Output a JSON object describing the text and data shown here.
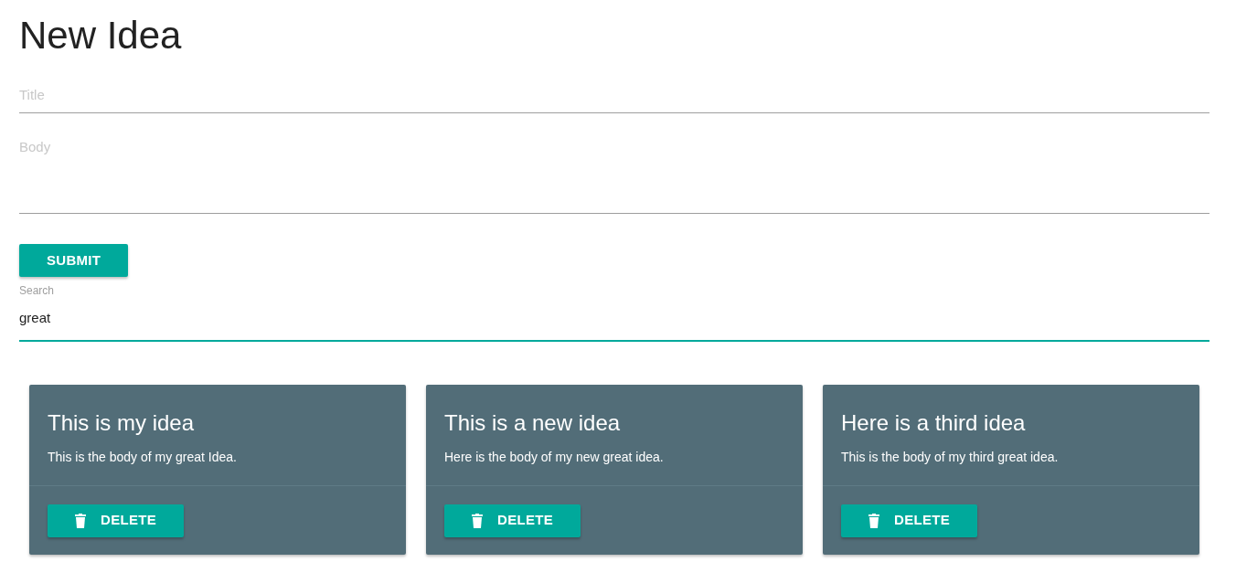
{
  "heading": "New Idea",
  "form": {
    "title_field": {
      "placeholder": "Title"
    },
    "body_field": {
      "placeholder": "Body"
    },
    "submit_button": "SUBMIT"
  },
  "search": {
    "label": "Search",
    "value": "great",
    "focused": true
  },
  "ideas": [
    {
      "title": "This is my idea",
      "body": "This is the body of my great Idea.",
      "delete_button": "DELETE"
    },
    {
      "title": "This is a new idea",
      "body": "Here is the body of my new great idea.",
      "delete_button": "DELETE"
    },
    {
      "title": "Here is a third idea",
      "body": "This is the body of my third great idea.",
      "delete_button": "DELETE"
    }
  ]
}
